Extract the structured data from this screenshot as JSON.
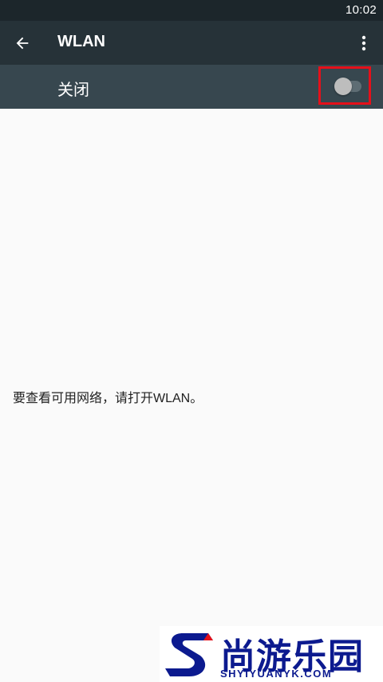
{
  "status_bar": {
    "time": "10:02"
  },
  "app_bar": {
    "title": "WLAN",
    "back_icon": "arrow-back-icon",
    "overflow_icon": "more-vert-icon"
  },
  "wlan_switch": {
    "label": "关闭",
    "state": "off"
  },
  "empty_state": {
    "message": "要查看可用网络，请打开WLAN。"
  },
  "watermark": {
    "name": "尚游乐园",
    "domain": "SHYIYUANYK.COM"
  },
  "colors": {
    "app_bar": "#263238",
    "switch_bar": "#37474f",
    "status_bar": "#1c262b",
    "background": "#fafafa",
    "highlight": "#e5101a",
    "watermark_text": "#0c1a8f"
  }
}
